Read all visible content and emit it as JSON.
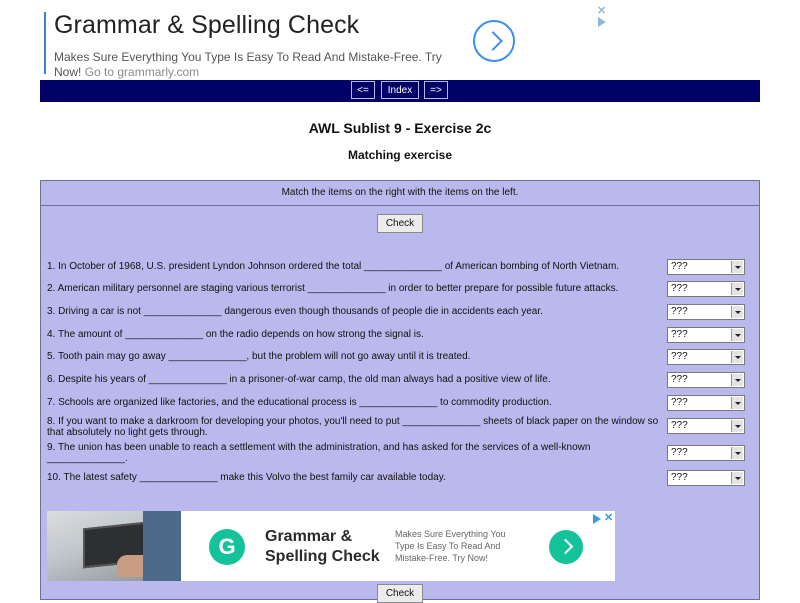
{
  "top_ad": {
    "title": "Grammar & Spelling Check",
    "description": "Makes Sure Everything You Type Is Easy To Read And Mistake-Free. Try Now!",
    "source": "Go to grammarly.com"
  },
  "nav": {
    "prev": "<=",
    "index": "Index",
    "next": "=>"
  },
  "page": {
    "title": "AWL Sublist 9 - Exercise 2c",
    "subtitle": "Matching exercise"
  },
  "exercise": {
    "instruction": "Match the items on the right with the items on the left.",
    "check_label": "Check",
    "questions": [
      {
        "text": "1. In October of 1968, U.S. president Lyndon Johnson ordered the total ______________ of American bombing of North Vietnam.",
        "answer": "???"
      },
      {
        "text": "2. American military personnel are staging various terrorist ______________ in order to better prepare for possible future attacks.",
        "answer": "???"
      },
      {
        "text": "3. Driving a car is not ______________ dangerous even though thousands of people die in accidents each year.",
        "answer": "???"
      },
      {
        "text": "4. The amount of ______________ on the radio depends on how strong the signal is.",
        "answer": "???"
      },
      {
        "text": "5. Tooth pain may go away ______________, but the problem will not go away until it is treated.",
        "answer": "???"
      },
      {
        "text": "6. Despite his years of ______________ in a prisoner-of-war camp, the old man always had a positive view of life.",
        "answer": "???"
      },
      {
        "text": "7. Schools are organized like factories, and the educational process is ______________ to commodity production.",
        "answer": "???"
      },
      {
        "text": "8. If you want to make a darkroom for developing your photos, you'll need to put ______________ sheets of black paper on the window so that absolutely no light gets through.",
        "answer": "???"
      },
      {
        "text": "9. The union has been unable to reach a settlement with the administration, and has asked for the services of a well-known ______________.",
        "answer": "???"
      },
      {
        "text": "10. The latest safety ______________ make this Volvo the best family car available today.",
        "answer": "???"
      }
    ]
  },
  "bottom_ad": {
    "title": "Grammar & Spelling Check",
    "description": "Makes Sure Everything You Type Is Easy To Read And Mistake-Free. Try Now!",
    "logo_letter": "G"
  },
  "colors": {
    "nav_bg": "#000066",
    "exercise_bg": "#b9b9ee",
    "brand_green": "#15c39a",
    "ad_blue": "#3b8ef0"
  }
}
